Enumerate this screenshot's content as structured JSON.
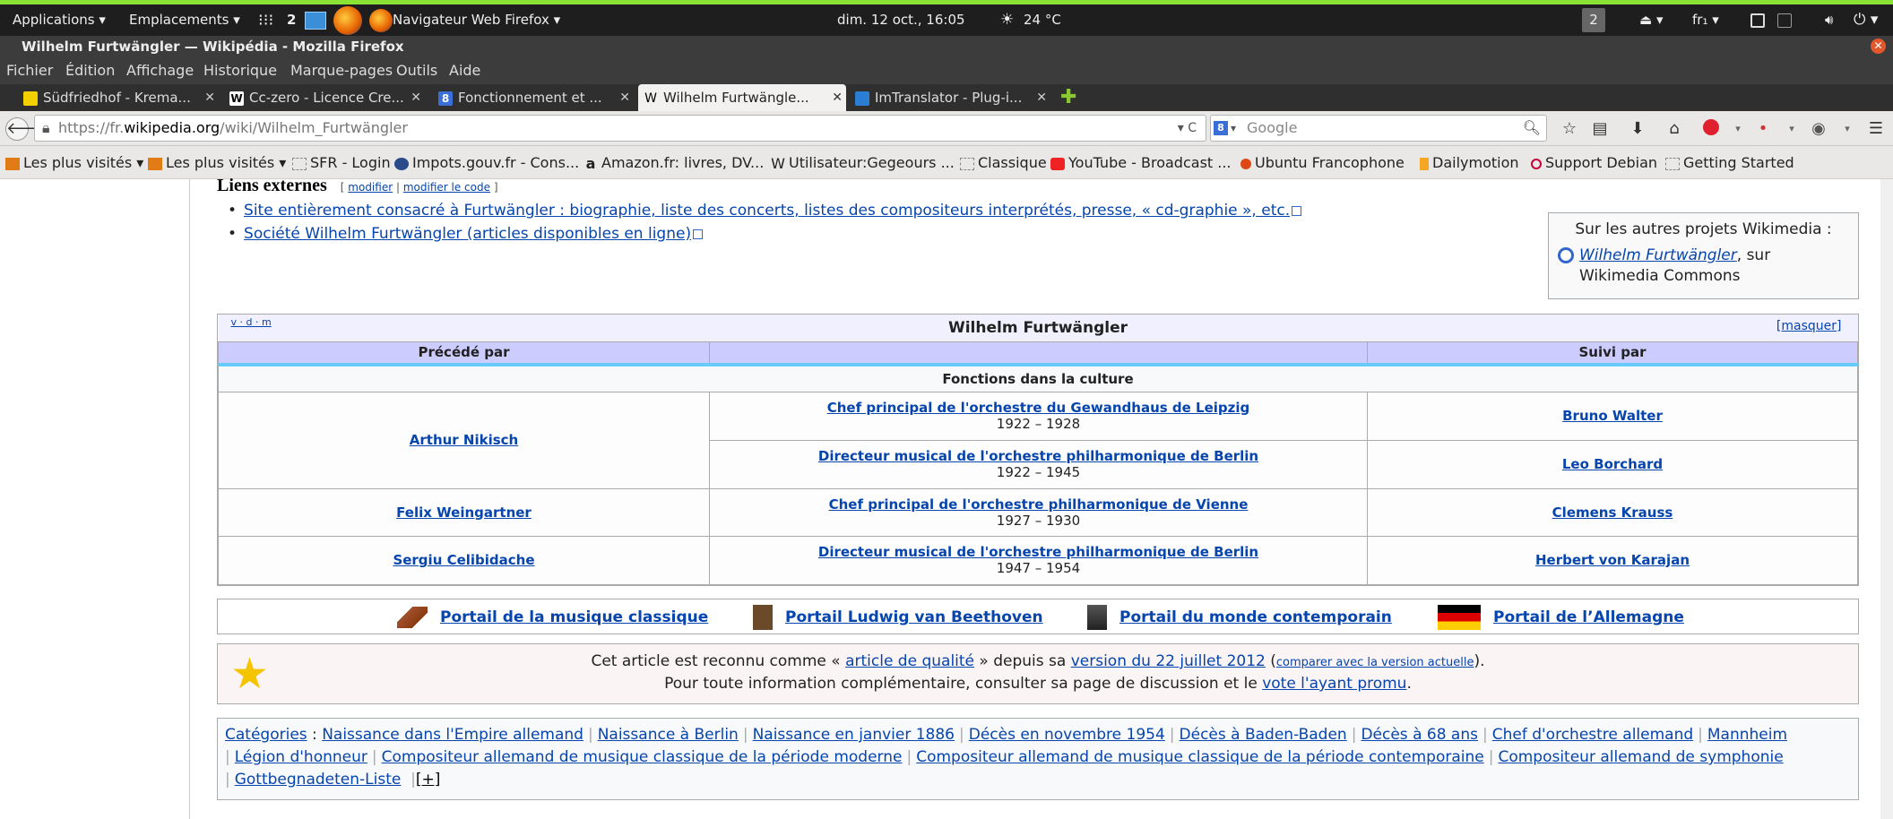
{
  "panel": {
    "applications": "Applications ▾",
    "places": "Emplacements ▾",
    "workspace": "2",
    "window_title": "Navigateur Web Firefox ▾",
    "datetime": "dim. 12 oct., 16:05",
    "weather": "24 °C",
    "workspace_badge": "2",
    "keyboard": "fr₁ ▾"
  },
  "window": {
    "title": "Wilhelm Furtwängler — Wikipédia - Mozilla Firefox"
  },
  "menu": [
    "Fichier",
    "Édition",
    "Affichage",
    "Historique",
    "Marque-pages",
    "Outils",
    "Aide"
  ],
  "tabs": [
    {
      "label": "Südfriedhof - Krema...",
      "color": "#f5d000"
    },
    {
      "label": "Cc-zero - Licence Cre...",
      "color": "#ffffff"
    },
    {
      "label": "Fonctionnement et ...",
      "color": "#3b6fd8"
    },
    {
      "label": "Wilhelm Furtwängle...",
      "color": "#ffffff"
    },
    {
      "label": "ImTranslator - Plug-i...",
      "color": "#2a7fd4"
    }
  ],
  "nav": {
    "url_host": "https://fr.",
    "url_domain": "wikipedia.org",
    "url_path": "/wiki/Wilhelm_Furtwängler",
    "search_placeholder": "Google"
  },
  "bookmarks": [
    "Les plus visités ▾",
    "Les plus visités ▾",
    "SFR - Login",
    "Impots.gouv.fr - Cons...",
    "Amazon.fr: livres, DV...",
    "Utilisateur:Gegeours ...",
    "Classique",
    "YouTube - Broadcast ...",
    "Ubuntu Francophone",
    "Dailymotion",
    "Support Debian",
    "Getting Started"
  ],
  "article": {
    "heading": "Liens externes",
    "edit_open": "[",
    "edit_modify": "modifier",
    "edit_sep": "|",
    "edit_code": "modifier le code",
    "edit_close": "]",
    "links": [
      "Site entièrement consacré à Furtwängler : biographie, liste des concerts, listes des compositeurs interprétés, presse, « cd-graphie », etc.",
      "Société Wilhelm Furtwängler (articles disponibles en ligne)"
    ],
    "sister": {
      "title": "Sur les autres projets Wikimedia :",
      "link": "Wilhelm Furtwängler",
      "suffix": ", sur Wikimedia Commons"
    }
  },
  "navbox": {
    "vdm": "v · d · m",
    "title": "Wilhelm Furtwängler",
    "hide": "[masquer]",
    "preceded": "Précédé par",
    "followed": "Suivi par",
    "section": "Fonctions dans la culture",
    "rows": [
      {
        "prev": "Arthur Nikisch",
        "role": "Chef principal de l'orchestre du Gewandhaus de Leipzig",
        "years": "1922 – 1928",
        "next": "Bruno Walter"
      },
      {
        "prev": "",
        "role": "Directeur musical de l'orchestre philharmonique de Berlin",
        "years": "1922 – 1945",
        "next": "Leo Borchard"
      },
      {
        "prev": "Felix Weingartner",
        "role": "Chef principal de l'orchestre philharmonique de Vienne",
        "years": "1927 – 1930",
        "next": "Clemens Krauss"
      },
      {
        "prev": "Sergiu Celibidache",
        "role": "Directeur musical de l'orchestre philharmonique de Berlin",
        "years": "1947 – 1954",
        "next": "Herbert von Karajan"
      }
    ]
  },
  "portals": [
    "Portail de la musique classique",
    "Portail Ludwig van Beethoven",
    "Portail du monde contemporain",
    "Portail de l’Allemagne"
  ],
  "quality": {
    "l1_a": "Cet article est reconnu comme « ",
    "l1_link": "article de qualité",
    "l1_b": " » depuis sa ",
    "l1_link2": "version du 22 juillet 2012",
    "l1_c": " (",
    "l1_link3": "comparer avec la version actuelle",
    "l1_d": ").",
    "l2_a": "Pour toute information complémentaire, consulter sa page de discussion et le ",
    "l2_link": "vote l'ayant promu",
    "l2_b": "."
  },
  "categories": {
    "label": "Catégories",
    "items": [
      "Naissance dans l'Empire allemand",
      "Naissance à Berlin",
      "Naissance en janvier 1886",
      "Décès en novembre 1954",
      "Décès à Baden-Baden",
      "Décès à 68 ans",
      "Chef d'orchestre allemand",
      "Mannheim",
      "Légion d'honneur",
      "Compositeur allemand de musique classique de la période moderne",
      "Compositeur allemand de musique classique de la période contemporaine",
      "Compositeur allemand de symphonie",
      "Gottbegnadeten-Liste"
    ],
    "more": "[+]"
  }
}
